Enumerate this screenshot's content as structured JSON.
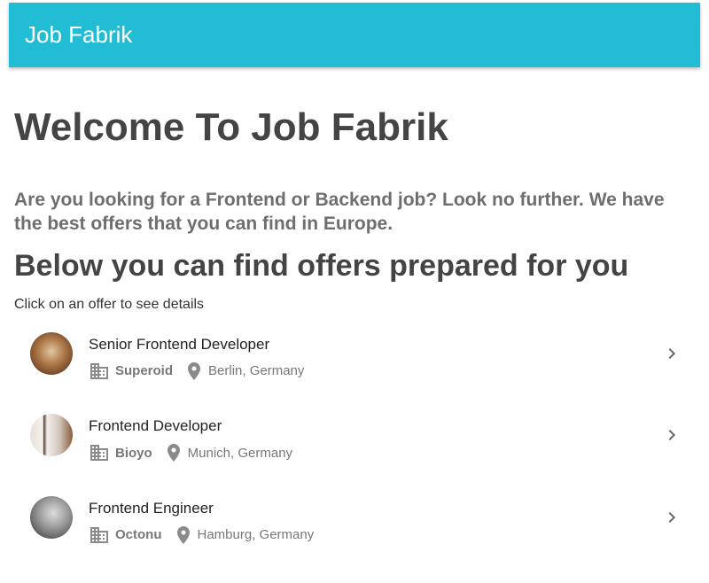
{
  "app": {
    "title": "Job Fabrik"
  },
  "main": {
    "welcome": "Welcome To Job Fabrik",
    "intro": "Are you looking for a Frontend or Backend job? Look no further. We have the best offers that you can find in Europe.",
    "offers_heading": "Below you can find offers prepared for you",
    "hint": "Click on an offer to see details"
  },
  "offers": [
    {
      "title": "Senior Frontend Developer",
      "company": "Superoid",
      "location": "Berlin, Germany",
      "avatar_icon": "cat-photo-avatar"
    },
    {
      "title": "Frontend Developer",
      "company": "Bioyo",
      "location": "Munich, Germany",
      "avatar_icon": "room-photo-avatar"
    },
    {
      "title": "Frontend Engineer",
      "company": "Octonu",
      "location": "Hamburg, Germany",
      "avatar_icon": "cat-photo-avatar"
    }
  ],
  "colors": {
    "toolbar": "#22bcd4",
    "heading": "#444444",
    "intro": "#6e6e6e",
    "meta": "#777777"
  },
  "icons": {
    "company": "domain-icon",
    "location": "place-icon",
    "open": "chevron-right-icon"
  }
}
